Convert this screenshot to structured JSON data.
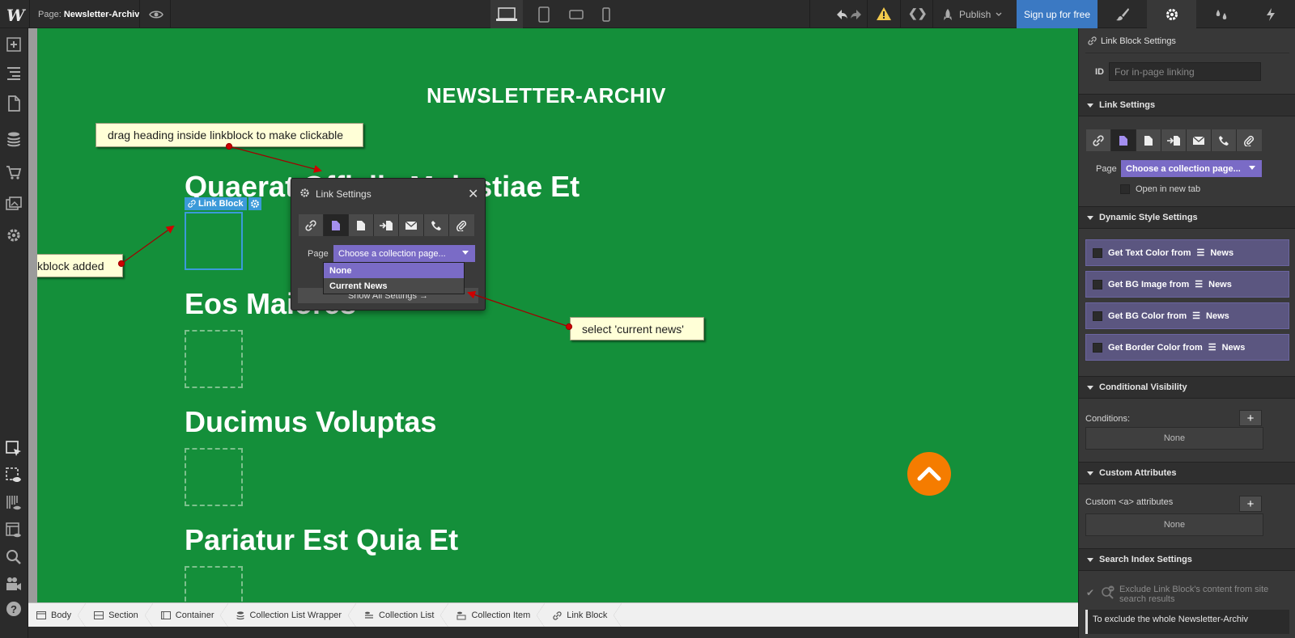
{
  "topbar": {
    "page_prefix": "Page:",
    "page_name": "Newsletter-Archiv",
    "publish_label": "Publish",
    "signup_label": "Sign up for free",
    "code_label": "❮❯"
  },
  "canvas": {
    "title": "NEWSLETTER-ARCHIV",
    "headings": [
      "Quaerat Officiis Molestiae Et",
      "Eos Maiores",
      "Ducimus Voluptas",
      "Pariatur Est Quia Et"
    ],
    "link_block_tag": "Link Block"
  },
  "notes": {
    "drag": "drag heading inside linkblock to make clickable",
    "added": "linkblock added",
    "select": "select 'current news'"
  },
  "popup": {
    "title": "Link Settings",
    "page_label": "Page",
    "select_value": "Choose a collection page...",
    "options": [
      "None",
      "Current News"
    ],
    "show_all": "Show All Settings"
  },
  "breadcrumbs": [
    "Body",
    "Section",
    "Container",
    "Collection List Wrapper",
    "Collection List",
    "Collection Item",
    "Link Block"
  ],
  "panel": {
    "header": "Link Block Settings",
    "id_label": "ID",
    "id_placeholder": "For in-page linking",
    "link_settings": "Link Settings",
    "page_label": "Page",
    "page_select": "Choose a collection page...",
    "new_tab": "Open in new tab",
    "dynamic_style": "Dynamic Style Settings",
    "dynamic_items": [
      "Get Text Color from",
      "Get BG Image from",
      "Get BG Color from",
      "Get Border Color from"
    ],
    "dynamic_source": "News",
    "conditional": "Conditional Visibility",
    "conditions_label": "Conditions:",
    "none_label": "None",
    "custom_attrs": "Custom Attributes",
    "custom_a_label": "Custom <a> attributes",
    "search_index": "Search Index Settings",
    "exclude_text": "Exclude Link Block's content from site search results",
    "exclude_note": "To exclude the whole Newsletter-Archiv"
  },
  "colors": {
    "canvas_bg": "#148f3a",
    "accent_purple": "#7a6bc6",
    "signup_blue": "#3b79c3",
    "orange": "#f57c00"
  }
}
